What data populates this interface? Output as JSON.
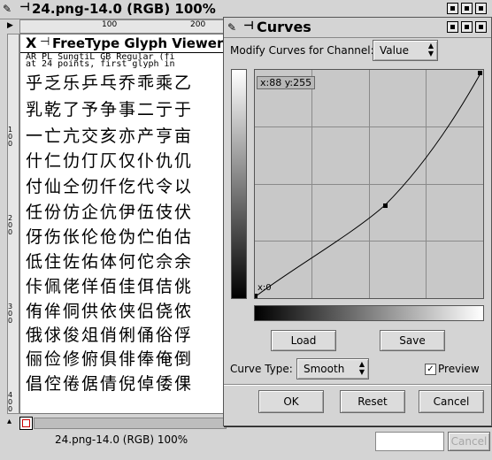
{
  "main_window": {
    "title": "24.png-14.0 (RGB) 100%",
    "status_text": "24.png-14.0 (RGB) 100%",
    "cancel_label": "Cancel",
    "ruler_top_labels": [
      "100",
      "200"
    ],
    "ruler_left_labels": [
      "100",
      "200",
      "300",
      "400"
    ]
  },
  "glyph_viewer": {
    "title": "FreeType Glyph Viewer",
    "info_line1": "AR PL SungtiL GB Regular (fi",
    "info_line2": "at 24 points, first glyph in",
    "rows": [
      "乎乏乐乒乓乔乖乘乙",
      "乳乾了予争事二亍于",
      "一亡亢交亥亦产亨亩",
      "什仁仂仃仄仅仆仇仉",
      "付仙仝仞仟仡代令以",
      "任份仿企伉伊伍伎伏",
      "伢伤伥伦伧伪伫伯估",
      "低住佐佑体何佗佘余",
      "佧佩佬佯佰佳佴佶佻",
      "侑侔侗供依侠侣侥侬",
      "俄俅俊俎俏俐俑俗俘",
      "俪俭修俯俱俳俸俺倒",
      "倡倥倦倨倩倪倬倭倮"
    ]
  },
  "curves": {
    "title": "Curves",
    "channel_label": "Modify Curves for Channel:",
    "channel_value": "Value",
    "coord_readout": "x:88 y:255",
    "corner_label": "x:0",
    "load_label": "Load",
    "save_label": "Save",
    "curve_type_label": "Curve Type:",
    "curve_type_value": "Smooth",
    "preview_label": "Preview",
    "preview_checked": true,
    "ok_label": "OK",
    "reset_label": "Reset",
    "cancel_label": "Cancel",
    "control_points": [
      [
        0,
        0
      ],
      [
        153,
        131
      ],
      [
        255,
        255
      ]
    ]
  }
}
